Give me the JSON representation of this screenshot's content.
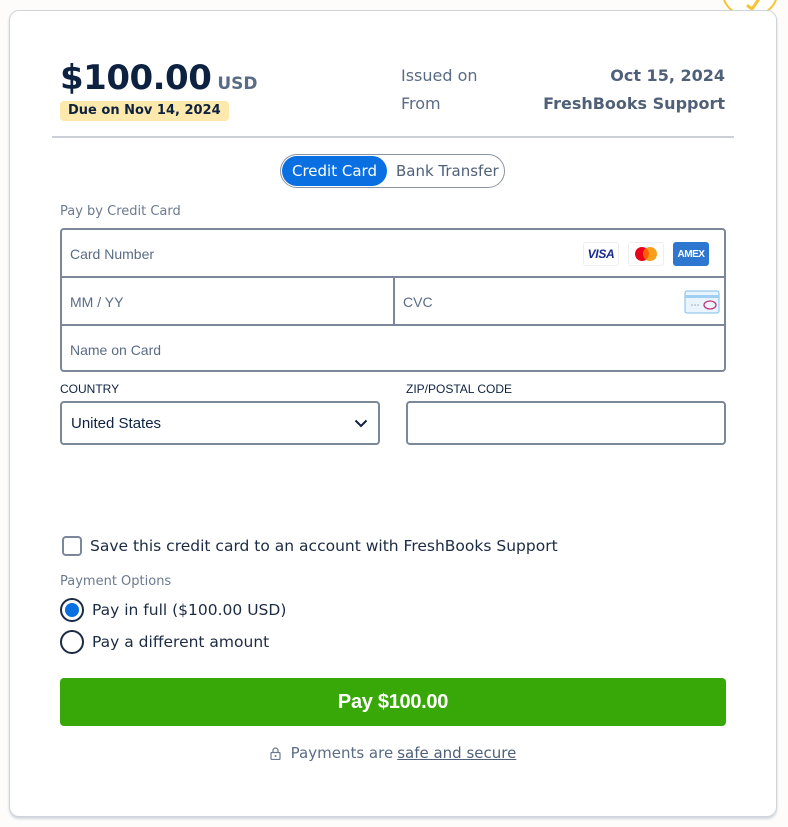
{
  "invoice": {
    "amount": "$100.00",
    "currency": "USD",
    "due_badge": "Due on Nov 14, 2024",
    "issued_label": "Issued on",
    "issued_value": "Oct 15, 2024",
    "from_label": "From",
    "from_value": "FreshBooks Support"
  },
  "payment_method_tabs": [
    {
      "label": "Credit Card",
      "active": true
    },
    {
      "label": "Bank Transfer",
      "active": false
    }
  ],
  "card_form": {
    "section_label": "Pay by Credit Card",
    "card_number_placeholder": "Card Number",
    "expiry_placeholder": "MM / YY",
    "cvc_placeholder": "CVC",
    "name_placeholder": "Name on Card",
    "brands": [
      {
        "name": "visa",
        "label": "VISA"
      },
      {
        "name": "mastercard",
        "label": ""
      },
      {
        "name": "amex",
        "label": "AMEX"
      }
    ]
  },
  "address": {
    "country_label": "COUNTRY",
    "country_value": "United States",
    "zip_label": "ZIP/POSTAL CODE",
    "zip_value": ""
  },
  "save_card": {
    "label": "Save this credit card to an account with FreshBooks Support",
    "checked": false
  },
  "payment_options": {
    "label": "Payment Options",
    "options": [
      {
        "label": "Pay in full ($100.00 USD)",
        "checked": true
      },
      {
        "label": "Pay a different amount",
        "checked": false
      }
    ]
  },
  "pay_button": {
    "label": "Pay $100.00"
  },
  "security": {
    "prefix": "Payments are",
    "link": "safe and secure"
  },
  "colors": {
    "primary_blue": "#0a6fe0",
    "pay_green": "#37a807",
    "due_badge_bg": "#fde9ab",
    "navy_text": "#0d2240",
    "accent_yellow": "#f6c431"
  }
}
